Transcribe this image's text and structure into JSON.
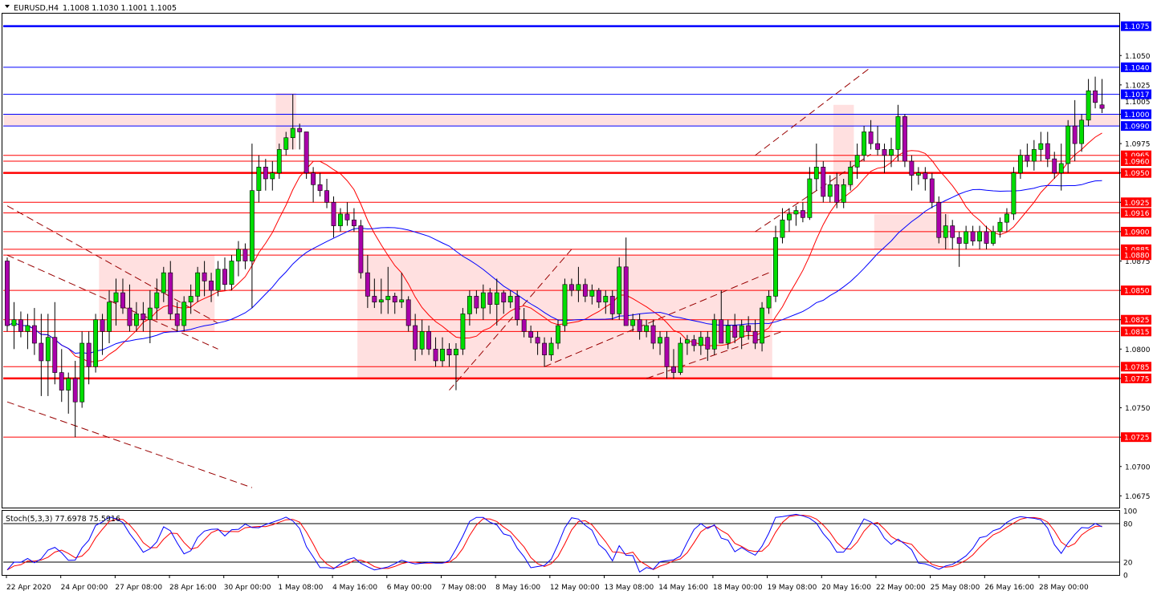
{
  "header": {
    "symbol_label": "EURUSD,H4",
    "ohlc_text": "1.1008 1.1030 1.1001 1.1005"
  },
  "stoch_label": "Stoch(5,3,3) 77.6978 75.5916",
  "colors": {
    "bull": "#00dd00",
    "bear": "#aa00aa",
    "wick": "#000000",
    "ma_fast": "#ff0000",
    "ma_slow": "#0000ff",
    "sr_red": "#ff0000",
    "sr_blue": "#0000ff",
    "zone": "#ffd5d5",
    "trend": "#990000",
    "stoch_main": "#0000ff",
    "stoch_signal": "#ff0000",
    "badge_text": "#ffffff"
  },
  "chart_data": {
    "type": "candlestick",
    "symbol": "EURUSD",
    "timeframe": "H4",
    "ylim": [
      1.0665,
      1.1085
    ],
    "grid": false,
    "price_axis_ticks": [
      "1.1050",
      "1.1025",
      "1.1000",
      "1.0975",
      "1.0950",
      "1.0925",
      "1.0900",
      "1.0875",
      "1.0850",
      "1.0825",
      "1.0800",
      "1.0775",
      "1.0750",
      "1.0725",
      "1.0700",
      "1.0675"
    ],
    "x_tick_labels": [
      "22 Apr 2020",
      "24 Apr 00:00",
      "27 Apr 08:00",
      "28 Apr 16:00",
      "30 Apr 00:00",
      "1 May 08:00",
      "4 May 16:00",
      "6 May 00:00",
      "7 May 08:00",
      "8 May 16:00",
      "12 May 00:00",
      "13 May 08:00",
      "14 May 16:00",
      "18 May 00:00",
      "19 May 08:00",
      "20 May 16:00",
      "22 May 00:00",
      "25 May 08:00",
      "26 May 16:00",
      "28 May 00:00"
    ],
    "current_price_label": "1.1005",
    "levels": [
      {
        "price": 1.1075,
        "label": "1.1075",
        "color": "blue",
        "thick": true
      },
      {
        "price": 1.104,
        "label": "1.1040",
        "color": "blue",
        "thick": false
      },
      {
        "price": 1.1017,
        "label": "1.1017",
        "color": "blue",
        "thick": false
      },
      {
        "price": 1.1,
        "label": "1.1000",
        "color": "blue",
        "thick": false
      },
      {
        "price": 1.099,
        "label": "1.0990",
        "color": "blue",
        "thick": false
      },
      {
        "price": 1.0965,
        "label": "1.0965",
        "color": "red",
        "thick": false
      },
      {
        "price": 1.096,
        "label": "1.0960",
        "color": "red",
        "thick": false
      },
      {
        "price": 1.095,
        "label": "1.0950",
        "color": "red",
        "thick": true
      },
      {
        "price": 1.0925,
        "label": "1.0925",
        "color": "red",
        "thick": false
      },
      {
        "price": 1.0916,
        "label": "1.0916",
        "color": "red",
        "thick": false
      },
      {
        "price": 1.09,
        "label": "1.0900",
        "color": "red",
        "thick": false
      },
      {
        "price": 1.0885,
        "label": "1.0885",
        "color": "red",
        "thick": false
      },
      {
        "price": 1.088,
        "label": "1.0880",
        "color": "red",
        "thick": false
      },
      {
        "price": 1.085,
        "label": "1.0850",
        "color": "red",
        "thick": false
      },
      {
        "price": 1.0825,
        "label": "1.0825",
        "color": "red",
        "thick": false
      },
      {
        "price": 1.0815,
        "label": "1.0815",
        "color": "red",
        "thick": false
      },
      {
        "price": 1.0785,
        "label": "1.0785",
        "color": "red",
        "thick": false
      },
      {
        "price": 1.0775,
        "label": "1.0775",
        "color": "red",
        "thick": true
      },
      {
        "price": 1.0725,
        "label": "1.0725",
        "color": "red",
        "thick": false
      }
    ],
    "zones": [
      {
        "bar_from": 0,
        "bar_to": 999,
        "price_from": 1.099,
        "price_to": 1.1
      },
      {
        "bar_from": 14,
        "bar_to": 30,
        "price_from": 1.0815,
        "price_to": 1.088
      },
      {
        "bar_from": 52,
        "bar_to": 112,
        "price_from": 1.0775,
        "price_to": 1.088
      },
      {
        "bar_from": 40,
        "bar_to": 42,
        "price_from": 1.097,
        "price_to": 1.1018
      },
      {
        "bar_from": 122,
        "bar_to": 124,
        "price_from": 1.0938,
        "price_to": 1.1008
      },
      {
        "bar_from": 128,
        "bar_to": 138,
        "price_from": 1.0885,
        "price_to": 1.0915
      }
    ],
    "trendlines": [
      {
        "from": [
          0,
          1.0922
        ],
        "to": [
          31,
          1.0822
        ]
      },
      {
        "from": [
          0,
          1.088
        ],
        "to": [
          31,
          1.08
        ]
      },
      {
        "from": [
          0,
          1.0755
        ],
        "to": [
          36,
          1.0682
        ]
      },
      {
        "from": [
          65,
          1.0765
        ],
        "to": [
          83,
          1.0885
        ]
      },
      {
        "from": [
          79,
          1.0785
        ],
        "to": [
          112,
          1.0865
        ]
      },
      {
        "from": [
          94,
          1.0775
        ],
        "to": [
          114,
          1.0815
        ]
      },
      {
        "from": [
          110,
          1.0965
        ],
        "to": [
          127,
          1.104
        ]
      },
      {
        "from": [
          110,
          1.09
        ],
        "to": [
          127,
          1.0966
        ]
      }
    ],
    "candles": [
      [
        1.0875,
        1.0878,
        1.0815,
        1.082
      ],
      [
        1.082,
        1.084,
        1.08,
        1.0825
      ],
      [
        1.0825,
        1.0832,
        1.081,
        1.0815
      ],
      [
        1.0815,
        1.083,
        1.08,
        1.082
      ],
      [
        1.082,
        1.0835,
        1.0795,
        1.0805
      ],
      [
        1.0805,
        1.083,
        1.076,
        1.079
      ],
      [
        1.079,
        1.083,
        1.076,
        1.081
      ],
      [
        1.081,
        1.084,
        1.077,
        1.078
      ],
      [
        1.078,
        1.08,
        1.0755,
        1.0765
      ],
      [
        1.0765,
        1.078,
        1.0745,
        1.0775
      ],
      [
        1.0775,
        1.079,
        1.0725,
        1.0755
      ],
      [
        1.0755,
        1.0815,
        1.075,
        1.0805
      ],
      [
        1.0805,
        1.0815,
        1.077,
        1.0785
      ],
      [
        1.0785,
        1.083,
        1.078,
        1.0825
      ],
      [
        1.0825,
        1.083,
        1.0795,
        1.0815
      ],
      [
        1.0815,
        1.085,
        1.0805,
        1.084
      ],
      [
        1.084,
        1.086,
        1.082,
        1.0848
      ],
      [
        1.0848,
        1.086,
        1.083,
        1.0835
      ],
      [
        1.0835,
        1.0855,
        1.0815,
        1.082
      ],
      [
        1.082,
        1.084,
        1.0815,
        1.083
      ],
      [
        1.083,
        1.084,
        1.0815,
        1.0825
      ],
      [
        1.0825,
        1.085,
        1.0805,
        1.0835
      ],
      [
        1.0835,
        1.086,
        1.0825,
        1.0848
      ],
      [
        1.0848,
        1.087,
        1.084,
        1.0865
      ],
      [
        1.0865,
        1.0875,
        1.0825,
        1.083
      ],
      [
        1.083,
        1.084,
        1.0815,
        1.082
      ],
      [
        1.082,
        1.0845,
        1.0815,
        1.084
      ],
      [
        1.084,
        1.0855,
        1.083,
        1.0845
      ],
      [
        1.0845,
        1.087,
        1.084,
        1.0865
      ],
      [
        1.0865,
        1.0875,
        1.0845,
        1.0858
      ],
      [
        1.0858,
        1.0865,
        1.084,
        1.085
      ],
      [
        1.085,
        1.0875,
        1.0845,
        1.0868
      ],
      [
        1.0868,
        1.0878,
        1.085,
        1.0855
      ],
      [
        1.0855,
        1.088,
        1.085,
        1.0875
      ],
      [
        1.0875,
        1.0892,
        1.0862,
        1.0885
      ],
      [
        1.0885,
        1.089,
        1.0868,
        1.0875
      ],
      [
        1.0875,
        1.0975,
        1.0835,
        1.0935
      ],
      [
        1.0935,
        1.0965,
        1.0925,
        1.0955
      ],
      [
        1.0955,
        1.0962,
        1.0935,
        1.0945
      ],
      [
        1.0945,
        1.096,
        1.0935,
        1.095
      ],
      [
        1.095,
        1.0975,
        1.0945,
        1.097
      ],
      [
        1.097,
        1.0985,
        1.0965,
        1.098
      ],
      [
        1.098,
        1.1017,
        1.097,
        1.0988
      ],
      [
        1.0988,
        1.0992,
        1.097,
        1.0985
      ],
      [
        1.0985,
        1.0985,
        1.0945,
        1.095
      ],
      [
        1.095,
        1.0955,
        1.0925,
        1.094
      ],
      [
        1.094,
        1.095,
        1.093,
        1.0935
      ],
      [
        1.0935,
        1.0945,
        1.092,
        1.0925
      ],
      [
        1.0925,
        1.093,
        1.0895,
        1.0905
      ],
      [
        1.0905,
        1.092,
        1.09,
        1.0915
      ],
      [
        1.0915,
        1.0925,
        1.0905,
        1.091
      ],
      [
        1.091,
        1.092,
        1.09,
        1.0905
      ],
      [
        1.0905,
        1.091,
        1.086,
        1.0865
      ],
      [
        1.0865,
        1.088,
        1.0835,
        1.0845
      ],
      [
        1.0845,
        1.086,
        1.0835,
        1.084
      ],
      [
        1.084,
        1.086,
        1.083,
        1.0842
      ],
      [
        1.0842,
        1.087,
        1.083,
        1.0845
      ],
      [
        1.0845,
        1.0848,
        1.083,
        1.084
      ],
      [
        1.084,
        1.0865,
        1.0835,
        1.0842
      ],
      [
        1.0842,
        1.0845,
        1.0815,
        1.082
      ],
      [
        1.082,
        1.083,
        1.079,
        1.08
      ],
      [
        1.08,
        1.0825,
        1.0795,
        1.0815
      ],
      [
        1.0815,
        1.082,
        1.0795,
        1.08
      ],
      [
        1.08,
        1.081,
        1.0785,
        1.079
      ],
      [
        1.079,
        1.081,
        1.0785,
        1.08
      ],
      [
        1.08,
        1.0805,
        1.0785,
        1.0795
      ],
      [
        1.0795,
        1.0805,
        1.0765,
        1.08
      ],
      [
        1.08,
        1.0835,
        1.0795,
        1.083
      ],
      [
        1.083,
        1.085,
        1.082,
        1.0845
      ],
      [
        1.0845,
        1.085,
        1.083,
        1.0835
      ],
      [
        1.0835,
        1.0855,
        1.0825,
        1.0848
      ],
      [
        1.0848,
        1.0852,
        1.083,
        1.0838
      ],
      [
        1.0838,
        1.086,
        1.082,
        1.0848
      ],
      [
        1.0848,
        1.085,
        1.083,
        1.084
      ],
      [
        1.084,
        1.085,
        1.0835,
        1.0845
      ],
      [
        1.0845,
        1.085,
        1.082,
        1.0825
      ],
      [
        1.0825,
        1.0835,
        1.081,
        1.0815
      ],
      [
        1.0815,
        1.082,
        1.0805,
        1.081
      ],
      [
        1.081,
        1.0815,
        1.0795,
        1.0805
      ],
      [
        1.0805,
        1.081,
        1.0785,
        1.0795
      ],
      [
        1.0795,
        1.081,
        1.079,
        1.0805
      ],
      [
        1.0805,
        1.0825,
        1.08,
        1.082
      ],
      [
        1.082,
        1.086,
        1.0815,
        1.0855
      ],
      [
        1.0855,
        1.086,
        1.0845,
        1.085
      ],
      [
        1.085,
        1.087,
        1.084,
        1.0855
      ],
      [
        1.0855,
        1.086,
        1.084,
        1.0845
      ],
      [
        1.0845,
        1.0855,
        1.0838,
        1.085
      ],
      [
        1.085,
        1.0852,
        1.0835,
        1.084
      ],
      [
        1.084,
        1.085,
        1.083,
        1.0845
      ],
      [
        1.0845,
        1.085,
        1.0825,
        1.083
      ],
      [
        1.083,
        1.0878,
        1.0825,
        1.087
      ],
      [
        1.087,
        1.0895,
        1.086,
        1.082
      ],
      [
        1.082,
        1.083,
        1.0815,
        1.0825
      ],
      [
        1.0825,
        1.083,
        1.0808,
        1.0815
      ],
      [
        1.0815,
        1.0825,
        1.081,
        1.082
      ],
      [
        1.082,
        1.0825,
        1.08,
        1.0805
      ],
      [
        1.0805,
        1.0815,
        1.0795,
        1.081
      ],
      [
        1.081,
        1.0815,
        1.0775,
        1.0785
      ],
      [
        1.0785,
        1.08,
        1.0775,
        1.078
      ],
      [
        1.078,
        1.081,
        1.0778,
        1.0805
      ],
      [
        1.0805,
        1.0812,
        1.0795,
        1.0808
      ],
      [
        1.0808,
        1.0812,
        1.0798,
        1.0803
      ],
      [
        1.0803,
        1.0815,
        1.0795,
        1.081
      ],
      [
        1.081,
        1.0815,
        1.079,
        1.08
      ],
      [
        1.08,
        1.083,
        1.0795,
        1.0825
      ],
      [
        1.0825,
        1.085,
        1.081,
        1.0805
      ],
      [
        1.0805,
        1.0825,
        1.08,
        1.082
      ],
      [
        1.082,
        1.083,
        1.0805,
        1.081
      ],
      [
        1.081,
        1.0825,
        1.08,
        1.082
      ],
      [
        1.082,
        1.0828,
        1.0808,
        1.0815
      ],
      [
        1.0815,
        1.0825,
        1.08,
        1.0805
      ],
      [
        1.0805,
        1.084,
        1.0798,
        1.0835
      ],
      [
        1.0835,
        1.085,
        1.083,
        1.0845
      ],
      [
        1.0845,
        1.0905,
        1.084,
        1.0895
      ],
      [
        1.0895,
        1.092,
        1.089,
        1.091
      ],
      [
        1.091,
        1.092,
        1.09,
        1.0915
      ],
      [
        1.0915,
        1.0922,
        1.0905,
        1.0918
      ],
      [
        1.0918,
        1.0925,
        1.0908,
        1.0912
      ],
      [
        1.0912,
        1.0955,
        1.091,
        1.0945
      ],
      [
        1.0945,
        1.0975,
        1.0935,
        1.0955
      ],
      [
        1.0955,
        1.096,
        1.0925,
        1.093
      ],
      [
        1.093,
        1.0948,
        1.0925,
        1.094
      ],
      [
        1.094,
        1.095,
        1.092,
        1.0925
      ],
      [
        1.0925,
        1.0945,
        1.092,
        1.094
      ],
      [
        1.094,
        1.096,
        1.0935,
        1.0955
      ],
      [
        1.0955,
        1.0975,
        1.0945,
        1.0965
      ],
      [
        1.0965,
        1.099,
        1.096,
        1.0985
      ],
      [
        1.0985,
        1.0995,
        1.097,
        1.0975
      ],
      [
        1.0975,
        1.099,
        1.0965,
        1.097
      ],
      [
        1.097,
        1.0975,
        1.095,
        1.0965
      ],
      [
        1.0965,
        1.098,
        1.0955,
        1.097
      ],
      [
        1.097,
        1.1008,
        1.096,
        1.0998
      ],
      [
        1.0998,
        1.1,
        1.0955,
        1.096
      ],
      [
        1.096,
        1.0965,
        1.0935,
        1.0948
      ],
      [
        1.0948,
        1.0955,
        1.094,
        1.095
      ],
      [
        1.095,
        1.0955,
        1.0935,
        1.0945
      ],
      [
        1.0945,
        1.095,
        1.092,
        1.0925
      ],
      [
        1.0925,
        1.093,
        1.089,
        1.0895
      ],
      [
        1.0895,
        1.0915,
        1.0885,
        1.0905
      ],
      [
        1.0905,
        1.091,
        1.0885,
        1.0895
      ],
      [
        1.0895,
        1.09,
        1.087,
        1.089
      ],
      [
        1.089,
        1.0905,
        1.0885,
        1.09
      ],
      [
        1.09,
        1.0905,
        1.0888,
        1.0892
      ],
      [
        1.0892,
        1.0905,
        1.0885,
        1.09
      ],
      [
        1.09,
        1.0905,
        1.0885,
        1.089
      ],
      [
        1.089,
        1.0905,
        1.0888,
        1.09
      ],
      [
        1.09,
        1.0912,
        1.0895,
        1.0908
      ],
      [
        1.0908,
        1.092,
        1.09,
        1.0915
      ],
      [
        1.0915,
        1.0955,
        1.091,
        1.095
      ],
      [
        1.095,
        1.097,
        1.0945,
        1.0965
      ],
      [
        1.0965,
        1.0975,
        1.0955,
        1.096
      ],
      [
        1.096,
        1.0978,
        1.0952,
        1.097
      ],
      [
        1.097,
        1.0985,
        1.096,
        1.0975
      ],
      [
        1.0975,
        1.0985,
        1.0955,
        1.0962
      ],
      [
        1.0962,
        1.0968,
        1.0945,
        1.095
      ],
      [
        1.095,
        1.0975,
        1.0935,
        1.0958
      ],
      [
        1.0958,
        1.0995,
        1.095,
        1.099
      ],
      [
        1.099,
        1.1012,
        1.096,
        1.0975
      ],
      [
        1.0975,
        1.1,
        1.0968,
        1.0995
      ],
      [
        1.0995,
        1.103,
        1.099,
        1.102
      ],
      [
        1.102,
        1.1032,
        1.1005,
        1.101
      ],
      [
        1.1008,
        1.103,
        1.1001,
        1.1005
      ]
    ],
    "ma_fast_period": 10,
    "ma_slow_period": 30,
    "stochastic": {
      "params": [
        5,
        3,
        3
      ],
      "main_last": 77.6978,
      "signal_last": 75.5916,
      "levels": [
        80,
        20
      ],
      "ylim": [
        0,
        100
      ],
      "axis_labels": [
        "100",
        "80",
        "20",
        "0"
      ]
    }
  }
}
